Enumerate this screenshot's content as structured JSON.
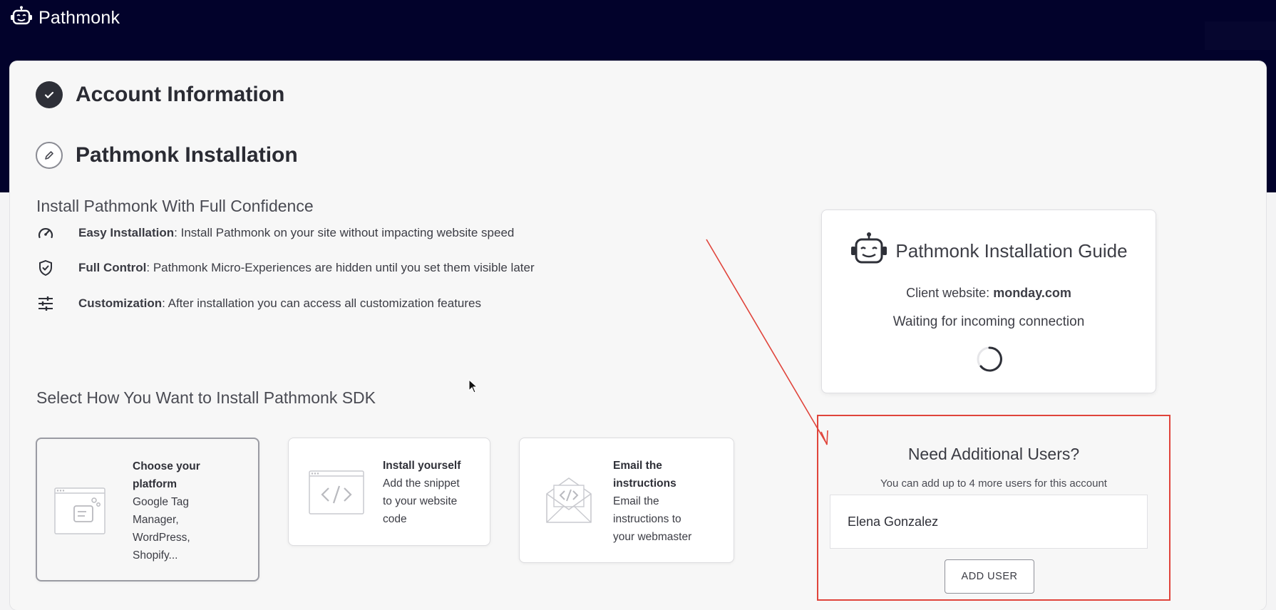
{
  "header": {
    "brand_name": "Pathmonk"
  },
  "steps": [
    {
      "title": "Account Information",
      "status": "completed"
    },
    {
      "title": "Pathmonk Installation",
      "status": "in-progress"
    }
  ],
  "install": {
    "heading": "Install Pathmonk With Full Confidence",
    "features": [
      {
        "icon": "speedometer-icon",
        "title": "Easy Installation",
        "text": ": Install Pathmonk on your site without impacting website speed"
      },
      {
        "icon": "shield-check-icon",
        "title": "Full Control",
        "text": ": Pathmonk Micro-Experiences are hidden until you set them visible later"
      },
      {
        "icon": "sliders-icon",
        "title": "Customization",
        "text": ": After installation you can access all customization features"
      }
    ],
    "select_heading": "Select How You Want to Install Pathmonk SDK",
    "options": [
      {
        "icon": "platform-window-icon",
        "title": "Choose your platform",
        "lines": [
          "Google Tag",
          "Manager,",
          "WordPress,",
          "Shopify..."
        ],
        "selected": true
      },
      {
        "icon": "code-window-icon",
        "title": "Install yourself",
        "lines": [
          "Add the snippet",
          "to your website",
          "code"
        ],
        "selected": false
      },
      {
        "icon": "code-envelope-icon",
        "title": "Email the instructions",
        "lines": [
          "Email the",
          "instructions to",
          "your webmaster"
        ],
        "selected": false
      }
    ]
  },
  "guide": {
    "title": "Pathmonk Installation Guide",
    "client_label": "Client website: ",
    "client_site": "monday.com",
    "status": "Waiting for incoming connection"
  },
  "users": {
    "title": "Need Additional Users?",
    "subtitle": "You can add up to 4 more users for this account",
    "input_value": "Elena Gonzalez",
    "button_label": "ADD USER"
  },
  "colors": {
    "header_bg": "#02022b",
    "highlight": "#e0443b",
    "step_done": "#2e3038"
  }
}
